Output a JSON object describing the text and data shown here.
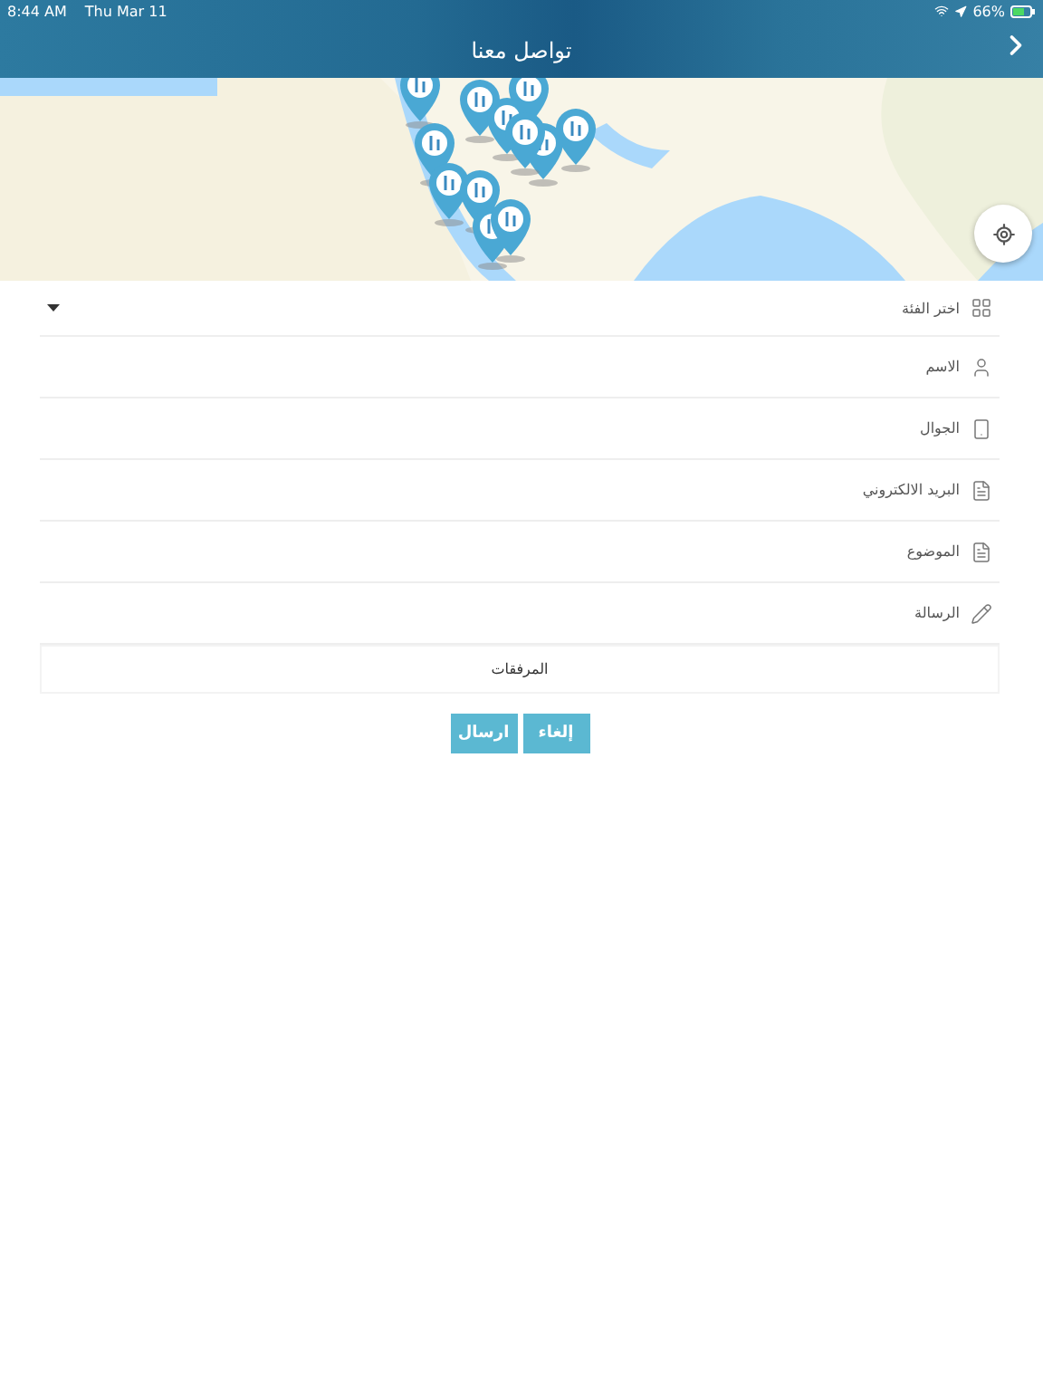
{
  "status_bar": {
    "time": "8:44 AM",
    "date": "Thu Mar 11",
    "battery": "66%"
  },
  "header": {
    "title": "تواصل معنا"
  },
  "form": {
    "fields": [
      {
        "kind": "select",
        "placeholder": "اختر الفئة"
      },
      {
        "kind": "text",
        "placeholder": "الاسم"
      },
      {
        "kind": "text",
        "placeholder": "الجوال"
      },
      {
        "kind": "text",
        "placeholder": "البريد الالكتروني"
      },
      {
        "kind": "text",
        "placeholder": "الموضوع"
      },
      {
        "kind": "text",
        "placeholder": "الرسالة"
      }
    ],
    "attachments": "المرفقات",
    "buttons": [
      {
        "label": "إلغاء"
      },
      {
        "label": "ارسال"
      }
    ]
  }
}
